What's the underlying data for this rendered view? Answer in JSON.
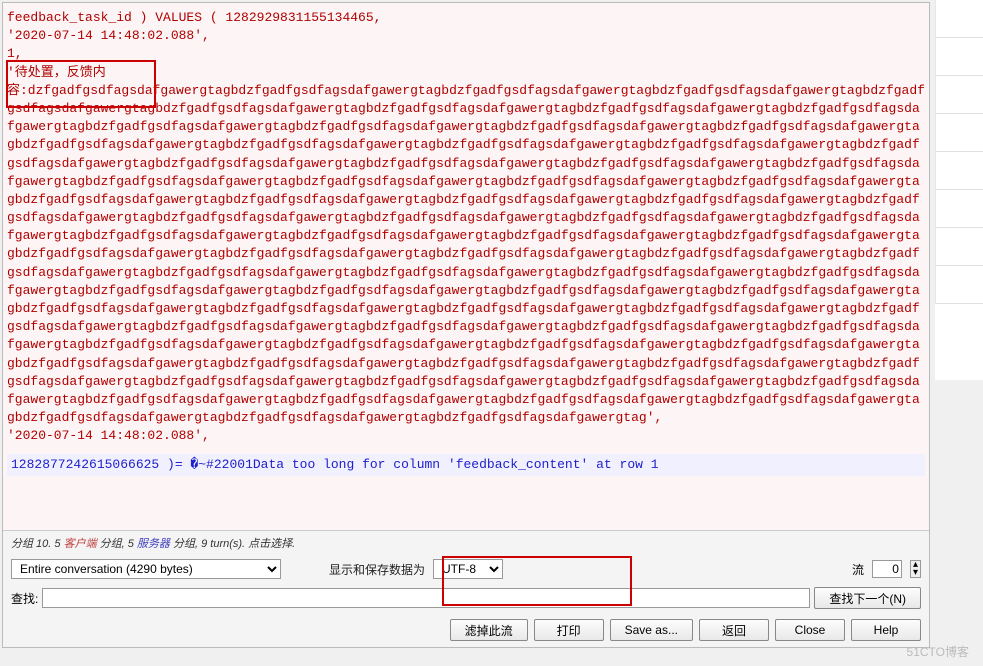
{
  "sql": {
    "header": "feedback_task_id )  VALUES  ( 1282929831155134465,",
    "timestamp1": "'2020-07-14 14:48:02.088',",
    "one": "1,",
    "status_prefix": "'待处置，反馈内",
    "long_text": "容:dzfgadfgsdfagsdafgawergtagbdzfgadfgsdfagsdafgawergtagbdzfgadfgsdfagsdafgawergtagbdzfgadfgsdfagsdafgawergtagbdzfgadfgsdfagsdafgawergtagbdzfgadfgsdfagsdafgawergtagbdzfgadfgsdfagsdafgawergtagbdzfgadfgsdfagsdafgawergtagbdzfgadfgsdfagsdafgawergtagbdzfgadfgsdfagsdafgawergtagbdzfgadfgsdfagsdafgawergtagbdzfgadfgsdfagsdafgawergtagbdzfgadfgsdfagsdafgawergtagbdzfgadfgsdfagsdafgawergtagbdzfgadfgsdfagsdafgawergtagbdzfgadfgsdfagsdafgawergtagbdzfgadfgsdfagsdafgawergtagbdzfgadfgsdfagsdafgawergtagbdzfgadfgsdfagsdafgawergtagbdzfgadfgsdfagsdafgawergtagbdzfgadfgsdfagsdafgawergtagbdzfgadfgsdfagsdafgawergtagbdzfgadfgsdfagsdafgawergtagbdzfgadfgsdfagsdafgawergtagbdzfgadfgsdfagsdafgawergtagbdzfgadfgsdfagsdafgawergtagbdzfgadfgsdfagsdafgawergtagbdzfgadfgsdfagsdafgawergtagbdzfgadfgsdfagsdafgawergtagbdzfgadfgsdfagsdafgawergtagbdzfgadfgsdfagsdafgawergtagbdzfgadfgsdfagsdafgawergtagbdzfgadfgsdfagsdafgawergtagbdzfgadfgsdfagsdafgawergtagbdzfgadfgsdfagsdafgawergtagbdzfgadfgsdfagsdafgawergtagbdzfgadfgsdfagsdafgawergtagbdzfgadfgsdfagsdafgawergtagbdzfgadfgsdfagsdafgawergtagbdzfgadfgsdfagsdafgawergtagbdzfgadfgsdfagsdafgawergtagbdzfgadfgsdfagsdafgawergtagbdzfgadfgsdfagsdafgawergtagbdzfgadfgsdfagsdafgawergtagbdzfgadfgsdfagsdafgawergtagbdzfgadfgsdfagsdafgawergtagbdzfgadfgsdfagsdafgawergtagbdzfgadfgsdfagsdafgawergtagbdzfgadfgsdfagsdafgawergtagbdzfgadfgsdfagsdafgawergtagbdzfgadfgsdfagsdafgawergtagbdzfgadfgsdfagsdafgawergtagbdzfgadfgsdfagsdafgawergtagbdzfgadfgsdfagsdafgawergtagbdzfgadfgsdfagsdafgawergtagbdzfgadfgsdfagsdafgawergtagbdzfgadfgsdfagsdafgawergtagbdzfgadfgsdfagsdafgawergtagbdzfgadfgsdfagsdafgawergtagbdzfgadfgsdfagsdafgawergtagbdzfgadfgsdfagsdafgawergtagbdzfgadfgsdfagsdafgawergtagbdzfgadfgsdfagsdafgawergtagbdzfgadfgsdfagsdafgawergtagbdzfgadfgsdfagsdafgawergtagbdzfgadfgsdfagsdafgawergtagbdzfgadfgsdfagsdafgawergtagbdzfgadfgsdfagsdafgawergtagbdzfgadfgsdfagsdafgawergtagbdzfgadfgsdfagsdafgawergtagbdzfgadfgsdfagsdafgawergtagbdzfgadfgsdfagsdafgawergtagbdzfgadfgsdfagsdafgawergtagbdzfgadfgsdfagsdafgawergtagbdzfgadfgsdfagsdafgawergtagbdzfgadfgsdfagsdafgawergtagbdzfgadfgsdfagsdafgawergtagbdzfgadfgsdfagsdafgawergtagbdzfgadfgsdfagsdafgawergtagbdzfgadfgsdfagsdafgawergtagbdzfgadfgsdfagsdafgawergtag',",
    "timestamp2": "'2020-07-14 14:48:02.088',"
  },
  "response": {
    "line": "1282877242615066625 )=    �~#22001Data too long for column 'feedback_content' at row 1"
  },
  "status": {
    "text_prefix": "分组 10. 5 ",
    "client_label": "客户端",
    "mid1": " 分组, 5 ",
    "server_label": "服务器",
    "suffix": " 分组, 9 turn(s). 点击选择."
  },
  "controls": {
    "conversation_select": "Entire conversation (4290 bytes)",
    "encoding_label": "显示和保存数据为",
    "encoding_select": "UTF-8",
    "stream_label": "流",
    "stream_value": "0"
  },
  "search": {
    "label": "查找:",
    "value": "",
    "findnext_button": "查找下一个(N)"
  },
  "buttons": {
    "filter": "滤掉此流",
    "print": "打印",
    "saveas": "Save as...",
    "back": "返回",
    "close": "Close",
    "help": "Help"
  },
  "watermark": "51CTO博客"
}
